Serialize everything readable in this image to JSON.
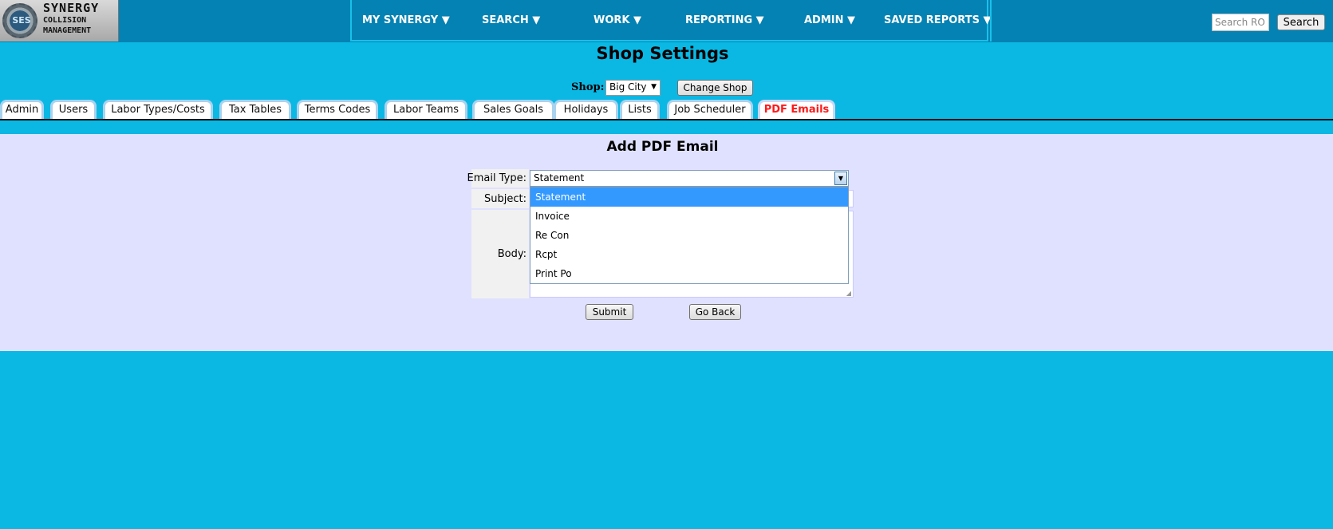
{
  "logo": {
    "gear_text": "SES",
    "line1": "SYNERGY",
    "line2": "COLLISION",
    "line3": "MANAGEMENT"
  },
  "nav": {
    "items": [
      "MY SYNERGY ▼",
      "SEARCH ▼",
      "WORK ▼",
      "REPORTING ▼",
      "ADMIN ▼",
      "SAVED REPORTS ▼"
    ]
  },
  "search": {
    "placeholder": "Search RO",
    "button": "Search"
  },
  "page": {
    "title": "Shop Settings"
  },
  "shop": {
    "label": "Shop:",
    "selected": "Big City",
    "change_button": "Change Shop"
  },
  "tabs": [
    "Admin",
    "Users",
    "Labor Types/Costs",
    "Tax Tables",
    "Terms Codes",
    "Labor Teams",
    "Sales Goals",
    "Holidays",
    "Lists",
    "Job Scheduler",
    "PDF Emails"
  ],
  "active_tab": "PDF Emails",
  "form": {
    "title": "Add PDF Email",
    "email_type_label": "Email Type:",
    "email_type_value": "Statement",
    "subject_label": "Subject:",
    "body_label": "Body:",
    "options": [
      "Statement",
      "Invoice",
      "Re Con",
      "Rcpt",
      "Print Po"
    ],
    "submit": "Submit",
    "go_back": "Go Back"
  },
  "colors": {
    "background": "#0bb8e4",
    "header": "#0382b3",
    "panel": "#e0e1fe",
    "active_tab_text": "#ff1a1a",
    "option_highlight": "#3399ff"
  }
}
